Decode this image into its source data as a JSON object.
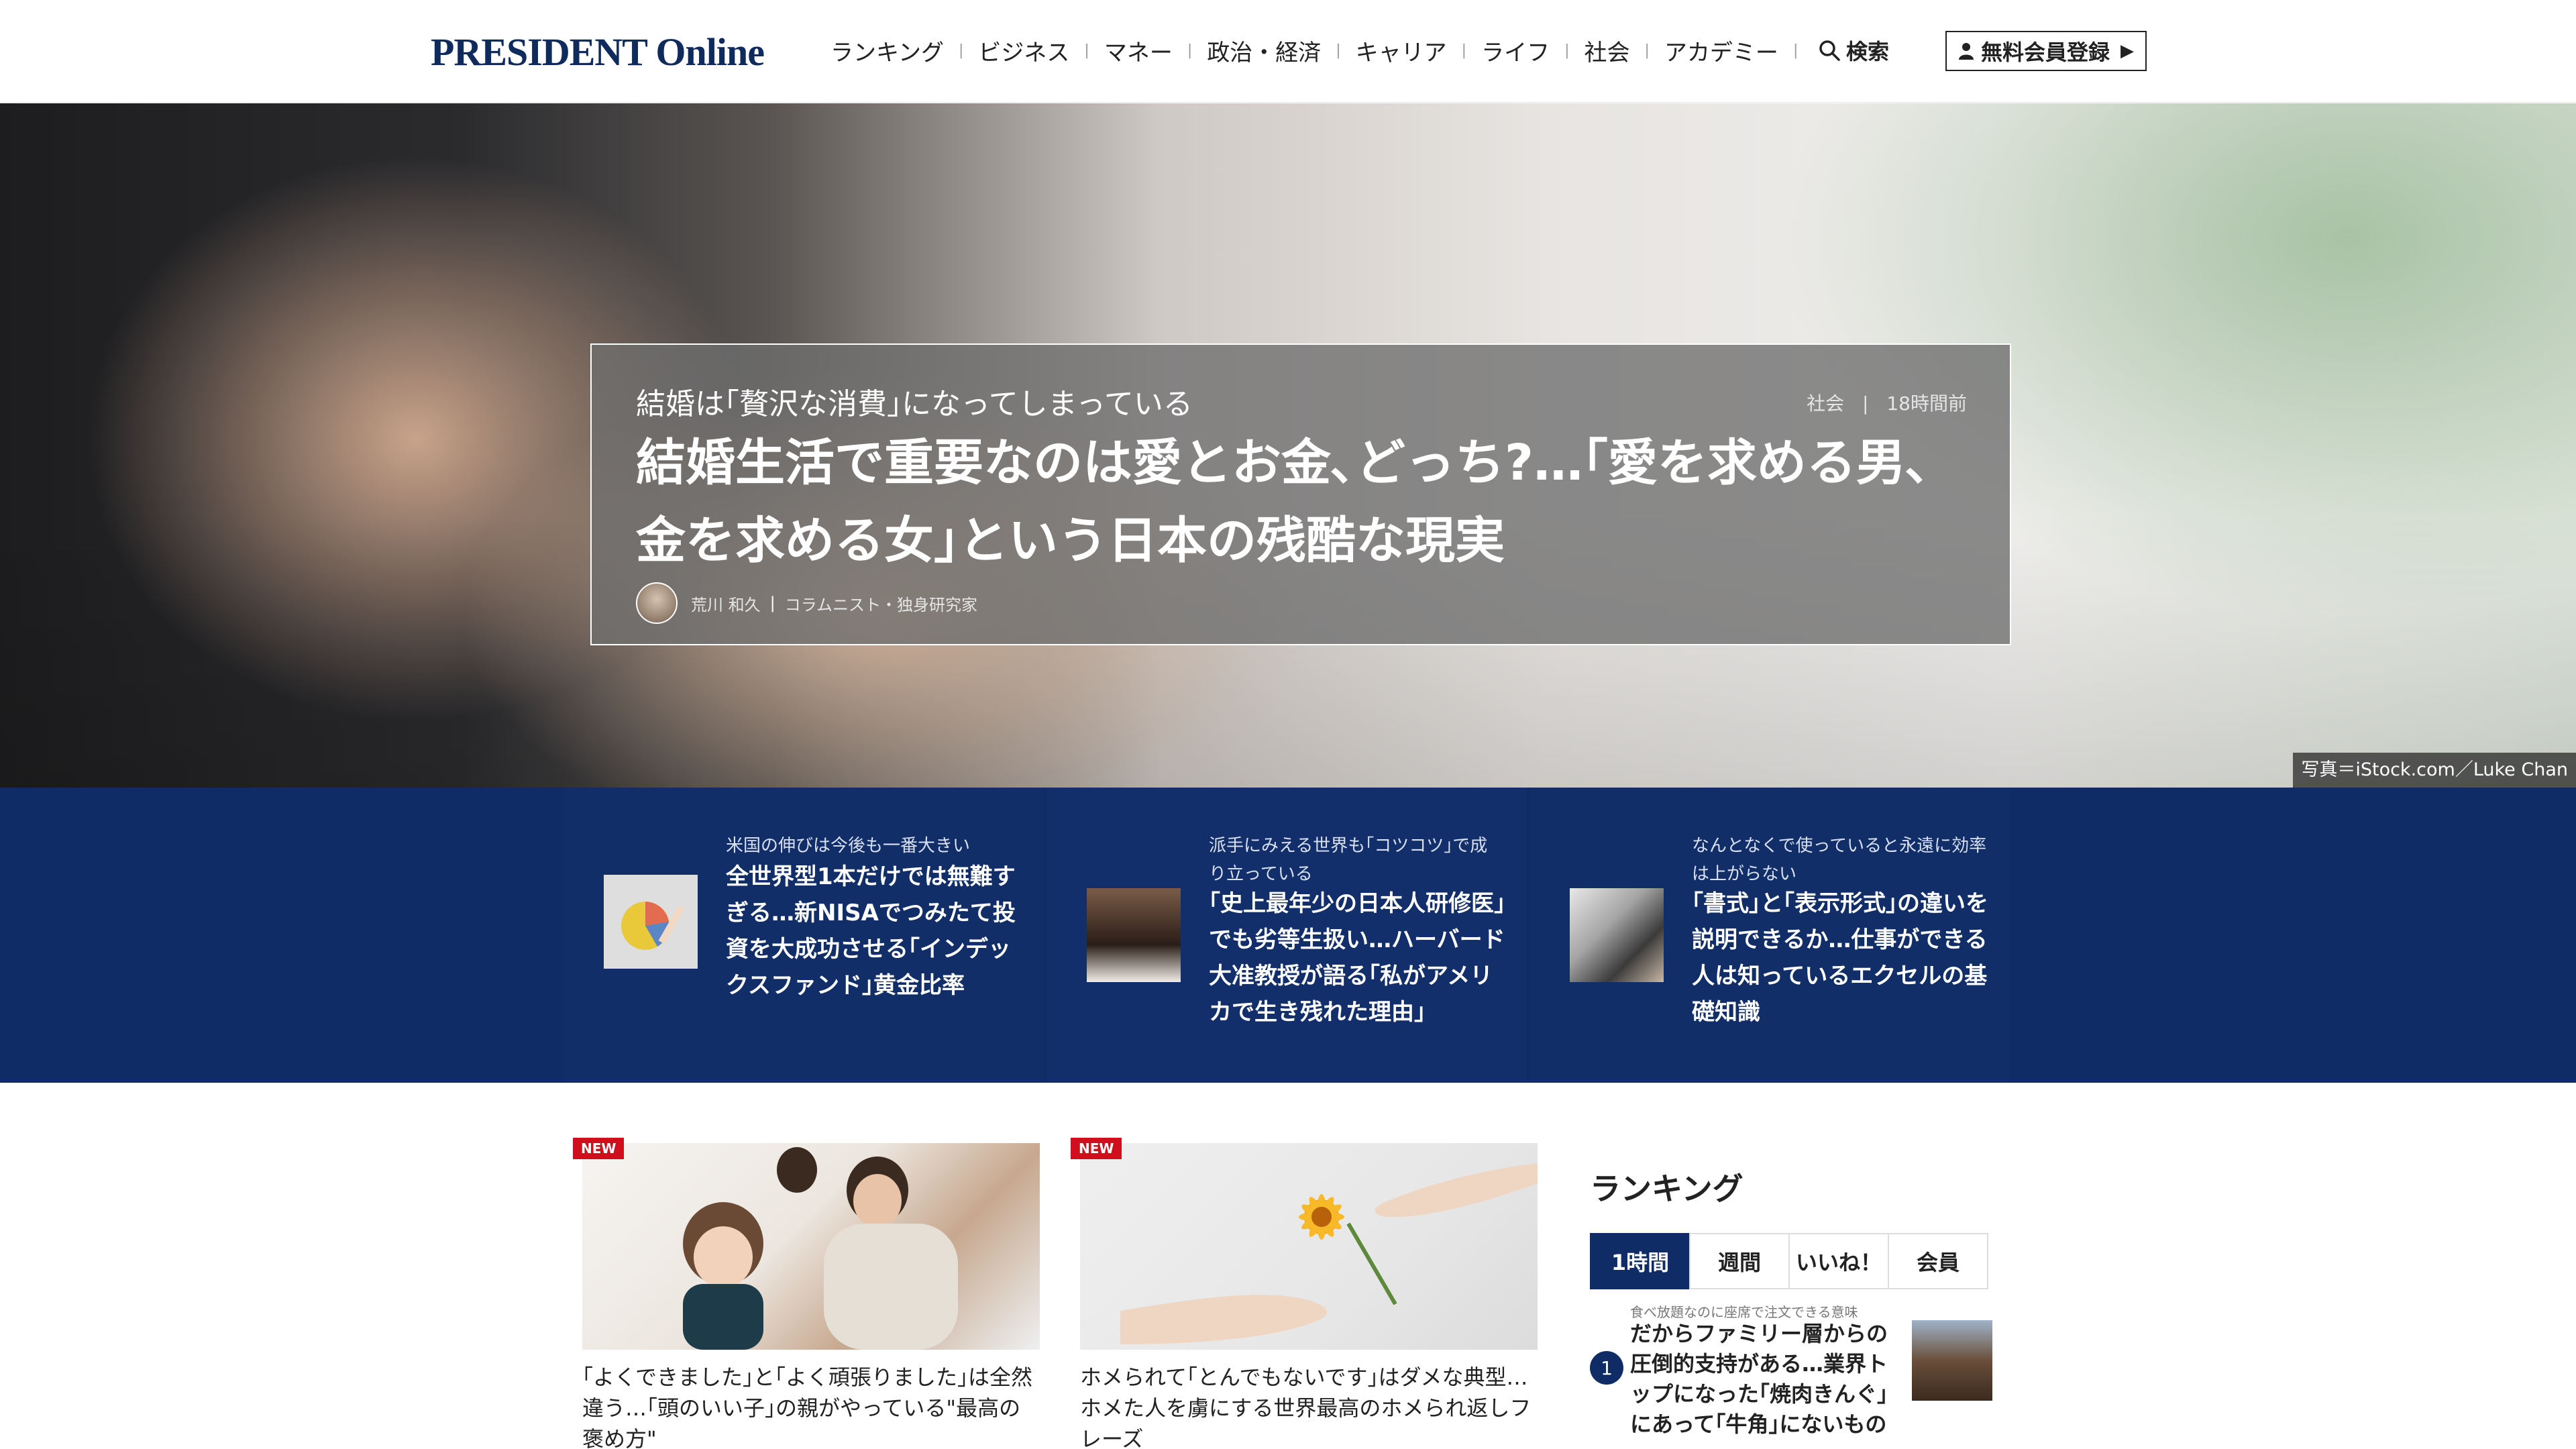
{
  "header": {
    "logo": "PRESIDENT Online",
    "nav": [
      "ランキング",
      "ビジネス",
      "マネー",
      "政治・経済",
      "キャリア",
      "ライフ",
      "社会",
      "アカデミー"
    ],
    "nav_sep": "|",
    "search_label": "検索",
    "signup_label": "無料会員登録"
  },
  "hero": {
    "subtitle": "結婚は｢贅沢な消費｣になってしまっている",
    "category": "社会",
    "time": "18時間前",
    "meta_sep": "|",
    "title": "結婚生活で重要なのは愛とお金､どっち?…｢愛を求める男､金を求める女｣という日本の残酷な現実",
    "author": "荒川 和久",
    "author_role": "コラムニスト・独身研究家",
    "photo_credit": "写真＝iStock.com／Luke Chan"
  },
  "features": [
    {
      "kicker": "米国の伸びは今後も一番大きい",
      "title": "全世界型1本だけでは無難すぎる…新NISAでつみたて投資を大成功させる｢インデックスファンド｣黄金比率",
      "thumb": "pie-chart-photo"
    },
    {
      "kicker": "派手にみえる世界も｢コツコツ｣で成り立っている",
      "title": "｢史上最年少の日本人研修医｣でも劣等生扱い…ハーバード大准教授が語る｢私がアメリカで生き残れた理由｣",
      "thumb": "woman-portrait-photo"
    },
    {
      "kicker": "なんとなくで使っていると永遠に効率は上がらない",
      "title": "｢書式｣と｢表示形式｣の違いを説明できるか…仕事ができる人は知っているエクセルの基礎知識",
      "thumb": "laptop-hand-photo"
    }
  ],
  "articles": [
    {
      "badge": "NEW",
      "title": "｢よくできました｣と｢よく頑張りました｣は全然違う…｢頭のいい子｣の親がやっている\"最高の褒め方\""
    },
    {
      "badge": "NEW",
      "title": "ホメられて｢とんでもないです｣はダメな典型…ホメた人を虜にする世界最高のホメられ返しフレーズ"
    }
  ],
  "ranking": {
    "heading": "ランキング",
    "tabs": [
      "1時間",
      "週間",
      "いいね！",
      "会員"
    ],
    "active_tab": "1時間",
    "items": [
      {
        "rank": "1",
        "kicker": "食べ放題なのに座席で注文できる意味",
        "title": "だからファミリー層からの圧倒的支持がある…業界トップになった｢焼肉きんぐ｣にあって｢牛角｣にないもの"
      }
    ]
  },
  "colors": {
    "brand_navy": "#0f2c66",
    "badge_red": "#d10f1c",
    "logo_navy": "#0f2a5c"
  }
}
